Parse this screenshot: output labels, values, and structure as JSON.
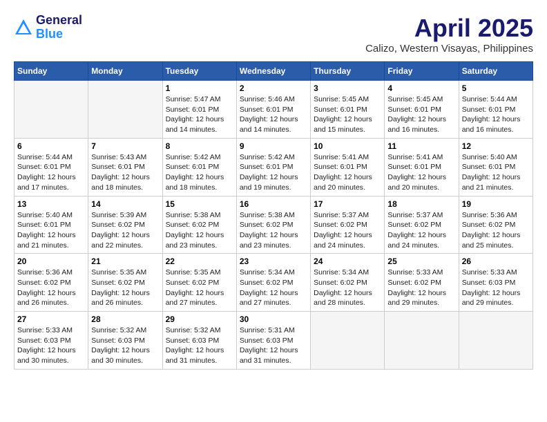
{
  "header": {
    "logo": {
      "line1": "General",
      "line2": "Blue"
    },
    "title": "April 2025",
    "subtitle": "Calizo, Western Visayas, Philippines"
  },
  "days_of_week": [
    "Sunday",
    "Monday",
    "Tuesday",
    "Wednesday",
    "Thursday",
    "Friday",
    "Saturday"
  ],
  "weeks": [
    [
      {
        "day": "",
        "info": ""
      },
      {
        "day": "",
        "info": ""
      },
      {
        "day": "1",
        "info": "Sunrise: 5:47 AM\nSunset: 6:01 PM\nDaylight: 12 hours and 14 minutes."
      },
      {
        "day": "2",
        "info": "Sunrise: 5:46 AM\nSunset: 6:01 PM\nDaylight: 12 hours and 14 minutes."
      },
      {
        "day": "3",
        "info": "Sunrise: 5:45 AM\nSunset: 6:01 PM\nDaylight: 12 hours and 15 minutes."
      },
      {
        "day": "4",
        "info": "Sunrise: 5:45 AM\nSunset: 6:01 PM\nDaylight: 12 hours and 16 minutes."
      },
      {
        "day": "5",
        "info": "Sunrise: 5:44 AM\nSunset: 6:01 PM\nDaylight: 12 hours and 16 minutes."
      }
    ],
    [
      {
        "day": "6",
        "info": "Sunrise: 5:44 AM\nSunset: 6:01 PM\nDaylight: 12 hours and 17 minutes."
      },
      {
        "day": "7",
        "info": "Sunrise: 5:43 AM\nSunset: 6:01 PM\nDaylight: 12 hours and 18 minutes."
      },
      {
        "day": "8",
        "info": "Sunrise: 5:42 AM\nSunset: 6:01 PM\nDaylight: 12 hours and 18 minutes."
      },
      {
        "day": "9",
        "info": "Sunrise: 5:42 AM\nSunset: 6:01 PM\nDaylight: 12 hours and 19 minutes."
      },
      {
        "day": "10",
        "info": "Sunrise: 5:41 AM\nSunset: 6:01 PM\nDaylight: 12 hours and 20 minutes."
      },
      {
        "day": "11",
        "info": "Sunrise: 5:41 AM\nSunset: 6:01 PM\nDaylight: 12 hours and 20 minutes."
      },
      {
        "day": "12",
        "info": "Sunrise: 5:40 AM\nSunset: 6:01 PM\nDaylight: 12 hours and 21 minutes."
      }
    ],
    [
      {
        "day": "13",
        "info": "Sunrise: 5:40 AM\nSunset: 6:01 PM\nDaylight: 12 hours and 21 minutes."
      },
      {
        "day": "14",
        "info": "Sunrise: 5:39 AM\nSunset: 6:02 PM\nDaylight: 12 hours and 22 minutes."
      },
      {
        "day": "15",
        "info": "Sunrise: 5:38 AM\nSunset: 6:02 PM\nDaylight: 12 hours and 23 minutes."
      },
      {
        "day": "16",
        "info": "Sunrise: 5:38 AM\nSunset: 6:02 PM\nDaylight: 12 hours and 23 minutes."
      },
      {
        "day": "17",
        "info": "Sunrise: 5:37 AM\nSunset: 6:02 PM\nDaylight: 12 hours and 24 minutes."
      },
      {
        "day": "18",
        "info": "Sunrise: 5:37 AM\nSunset: 6:02 PM\nDaylight: 12 hours and 24 minutes."
      },
      {
        "day": "19",
        "info": "Sunrise: 5:36 AM\nSunset: 6:02 PM\nDaylight: 12 hours and 25 minutes."
      }
    ],
    [
      {
        "day": "20",
        "info": "Sunrise: 5:36 AM\nSunset: 6:02 PM\nDaylight: 12 hours and 26 minutes."
      },
      {
        "day": "21",
        "info": "Sunrise: 5:35 AM\nSunset: 6:02 PM\nDaylight: 12 hours and 26 minutes."
      },
      {
        "day": "22",
        "info": "Sunrise: 5:35 AM\nSunset: 6:02 PM\nDaylight: 12 hours and 27 minutes."
      },
      {
        "day": "23",
        "info": "Sunrise: 5:34 AM\nSunset: 6:02 PM\nDaylight: 12 hours and 27 minutes."
      },
      {
        "day": "24",
        "info": "Sunrise: 5:34 AM\nSunset: 6:02 PM\nDaylight: 12 hours and 28 minutes."
      },
      {
        "day": "25",
        "info": "Sunrise: 5:33 AM\nSunset: 6:02 PM\nDaylight: 12 hours and 29 minutes."
      },
      {
        "day": "26",
        "info": "Sunrise: 5:33 AM\nSunset: 6:03 PM\nDaylight: 12 hours and 29 minutes."
      }
    ],
    [
      {
        "day": "27",
        "info": "Sunrise: 5:33 AM\nSunset: 6:03 PM\nDaylight: 12 hours and 30 minutes."
      },
      {
        "day": "28",
        "info": "Sunrise: 5:32 AM\nSunset: 6:03 PM\nDaylight: 12 hours and 30 minutes."
      },
      {
        "day": "29",
        "info": "Sunrise: 5:32 AM\nSunset: 6:03 PM\nDaylight: 12 hours and 31 minutes."
      },
      {
        "day": "30",
        "info": "Sunrise: 5:31 AM\nSunset: 6:03 PM\nDaylight: 12 hours and 31 minutes."
      },
      {
        "day": "",
        "info": ""
      },
      {
        "day": "",
        "info": ""
      },
      {
        "day": "",
        "info": ""
      }
    ]
  ]
}
